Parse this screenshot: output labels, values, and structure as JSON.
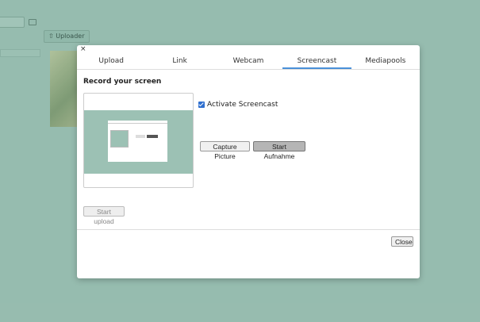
{
  "background": {
    "uploader_label": "Uploader",
    "uploader_icon": "upload-icon",
    "folder_icon": "folder-icon"
  },
  "modal": {
    "close_glyph": "×",
    "tabs": [
      {
        "label": "Upload",
        "active": false
      },
      {
        "label": "Link",
        "active": false
      },
      {
        "label": "Webcam",
        "active": false
      },
      {
        "label": "Screencast",
        "active": true
      },
      {
        "label": "Mediapools",
        "active": false
      }
    ],
    "heading": "Record your screen",
    "activate_label": "Activate Screencast",
    "activate_checked": true,
    "capture_label": "Capture Picture",
    "start_label": "Start Aufnahme",
    "upload_label": "Start upload",
    "close_label": "Close"
  },
  "colors": {
    "accent": "#4a90d9",
    "checkbox": "#2f6fcf",
    "backdrop": "#9cc1b4"
  }
}
